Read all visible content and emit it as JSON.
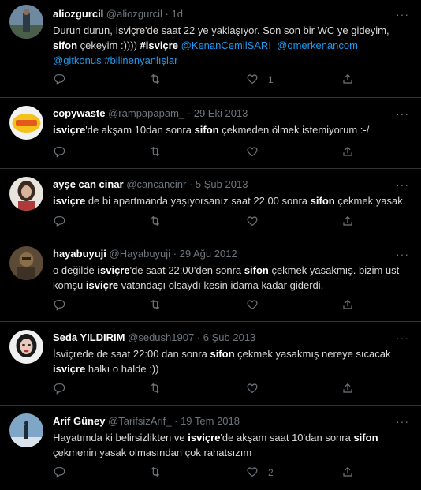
{
  "tweets": [
    {
      "name": "aliozgurcil",
      "handle": "@aliozgurcil",
      "sep": "·",
      "time": "1d",
      "lines": [
        [
          {
            "t": "Durun durun, İsviçre'de saat 22 ye yaklaşıyor. Son son bir WC ye gideyim,"
          }
        ],
        [
          {
            "t": "sifon",
            "b": true
          },
          {
            "t": " çekeyim :)))) "
          },
          {
            "t": "#isviçre",
            "l": true,
            "b": true
          },
          {
            "t": " "
          },
          {
            "t": "@KenanCemilSARI",
            "l": true
          },
          {
            "t": "  "
          },
          {
            "t": "@omerkenancom",
            "l": true
          }
        ],
        [
          {
            "t": "@gitkonus",
            "l": true
          },
          {
            "t": " "
          },
          {
            "t": "#bilinenyanlışlar",
            "l": true
          }
        ]
      ],
      "likes": "1"
    },
    {
      "name": "copywaste",
      "handle": "@rampapapam_",
      "sep": "·",
      "time": "29 Eki 2013",
      "lines": [
        [
          {
            "t": "isviçre",
            "b": true
          },
          {
            "t": "'de akşam 10dan sonra "
          },
          {
            "t": "sifon",
            "b": true
          },
          {
            "t": " çekmeden ölmek istemiyorum :-/"
          }
        ]
      ],
      "likes": ""
    },
    {
      "name": "ayşe can cinar",
      "handle": "@cancancinr",
      "sep": "·",
      "time": "5 Şub 2013",
      "lines": [
        [
          {
            "t": "isviçre",
            "b": true
          },
          {
            "t": " de bi apartmanda yaşıyorsanız saat 22.00 sonra "
          },
          {
            "t": "sifon",
            "b": true
          },
          {
            "t": " çekmek yasak."
          }
        ]
      ],
      "likes": ""
    },
    {
      "name": "hayabuyuji",
      "handle": "@Hayabuyuji",
      "sep": "·",
      "time": "29 Ağu 2012",
      "lines": [
        [
          {
            "t": "o değilde "
          },
          {
            "t": "isviçre",
            "b": true
          },
          {
            "t": "'de saat 22:00'den sonra "
          },
          {
            "t": "sifon",
            "b": true
          },
          {
            "t": " çekmek yasakmış. bizim üst"
          }
        ],
        [
          {
            "t": "komşu "
          },
          {
            "t": "isviçre",
            "b": true
          },
          {
            "t": " vatandaşı olsaydı kesin idama kadar giderdi."
          }
        ]
      ],
      "likes": ""
    },
    {
      "name": "Seda YILDIRIM",
      "handle": "@sedush1907",
      "sep": "·",
      "time": "6 Şub 2013",
      "lines": [
        [
          {
            "t": "İsviçrede de saat 22:00 dan sonra "
          },
          {
            "t": "sifon",
            "b": true
          },
          {
            "t": " çekmek yasakmış nereye sıcacak"
          }
        ],
        [
          {
            "t": "isviçre",
            "b": true
          },
          {
            "t": " halkı o halde :))"
          }
        ]
      ],
      "likes": ""
    },
    {
      "name": "Arif Güney",
      "handle": "@TarifsizArif_",
      "sep": "·",
      "time": "19 Tem 2018",
      "lines": [
        [
          {
            "t": "Hayatımda ki belirsizlikten ve "
          },
          {
            "t": "isviçre",
            "b": true
          },
          {
            "t": "'de akşam saat 10'dan sonra "
          },
          {
            "t": "sifon",
            "b": true
          }
        ],
        [
          {
            "t": "çekmenin yasak olmasından çok rahatsızım"
          }
        ]
      ],
      "likes": "2"
    }
  ],
  "icons": {
    "reply": "reply-icon",
    "retweet": "retweet-icon",
    "like": "heart-icon",
    "share": "share-icon",
    "more": "more-icon"
  },
  "colors": {
    "background": "#000000",
    "text": "#d9d9d9",
    "muted": "#6e767d",
    "link": "#1d9bf0",
    "divider": "#2f3336"
  }
}
